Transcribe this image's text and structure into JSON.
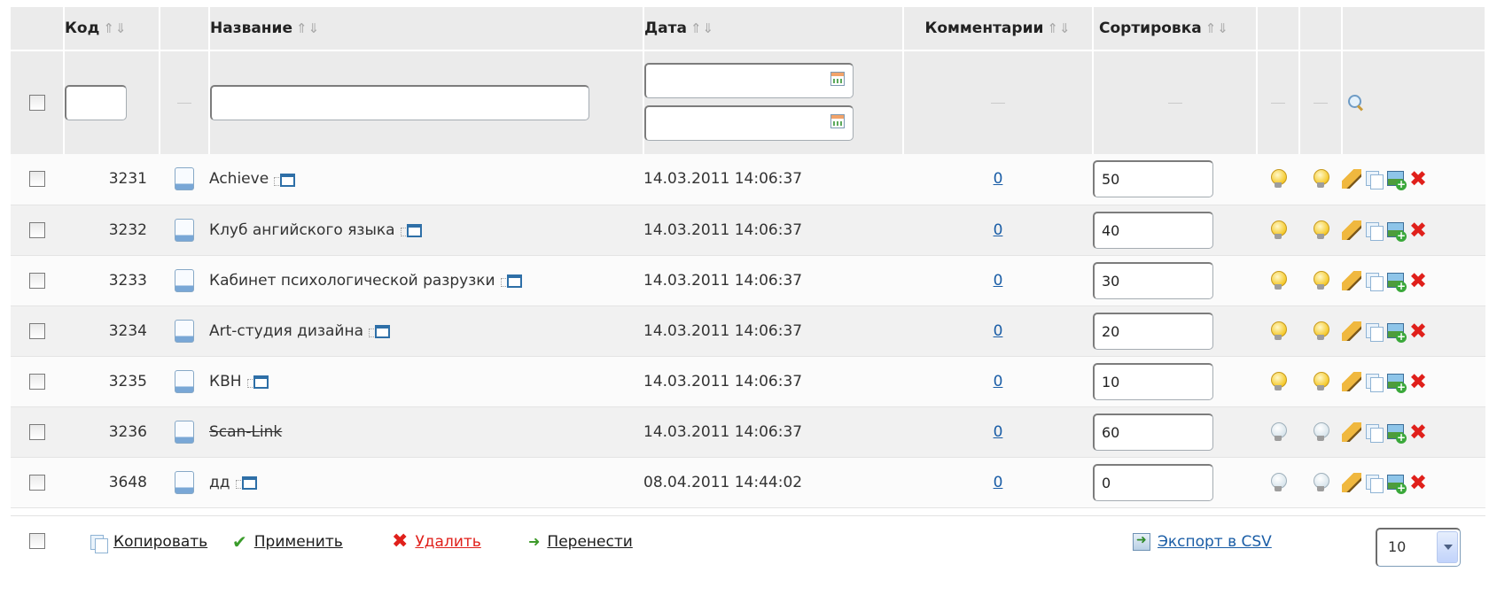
{
  "header": {
    "code": "Код",
    "name": "Название",
    "date": "Дата",
    "comments": "Комментарии",
    "sorting": "Сортировка",
    "sort_arrows": "⇑⇓"
  },
  "filter": {
    "code_value": "",
    "name_value": "",
    "date_from": "",
    "date_to": ""
  },
  "rows": [
    {
      "code": "3231",
      "name": "Achieve",
      "date": "14.03.2011 14:06:37",
      "comments": "0",
      "sort": "50"
    },
    {
      "code": "3232",
      "name": "Клуб ангийского языка",
      "date": "14.03.2011 14:06:37",
      "comments": "0",
      "sort": "40"
    },
    {
      "code": "3233",
      "name": "Кабинет психологической разрузки",
      "date": "14.03.2011 14:06:37",
      "comments": "0",
      "sort": "30"
    },
    {
      "code": "3234",
      "name": "Art-студия дизайна",
      "date": "14.03.2011 14:06:37",
      "comments": "0",
      "sort": "20"
    },
    {
      "code": "3235",
      "name": "КВН",
      "date": "14.03.2011 14:06:37",
      "comments": "0",
      "sort": "10"
    },
    {
      "code": "3236",
      "name": "Scan-Link",
      "date": "14.03.2011 14:06:37",
      "comments": "0",
      "sort": "60"
    },
    {
      "code": "3648",
      "name": "дд",
      "date": "08.04.2011 14:44:02",
      "comments": "0",
      "sort": "0"
    }
  ],
  "row_states": {
    "active_rows": [
      "3231",
      "3232",
      "3233",
      "3234",
      "3235"
    ],
    "inactive_rows": [
      "3236",
      "3648"
    ],
    "strikethrough_rows": [
      "3236"
    ]
  },
  "footer": {
    "copy": "Копировать",
    "apply": "Применить",
    "delete": "Удалить",
    "move": "Перенести",
    "export": "Экспорт в CSV",
    "page_size": "10"
  },
  "colors": {
    "link": "#1a5da6",
    "delete": "#e0201b",
    "header_bg": "#ebebeb"
  },
  "icons": [
    "checkbox-icon",
    "document-icon",
    "popup-window-icon",
    "calendar-icon",
    "search-icon",
    "lightbulb-icon",
    "pencil-icon",
    "copy-icon",
    "add-image-icon",
    "delete-icon",
    "checkmark-icon",
    "arrow-right-icon",
    "export-csv-icon",
    "chevron-down-icon"
  ]
}
